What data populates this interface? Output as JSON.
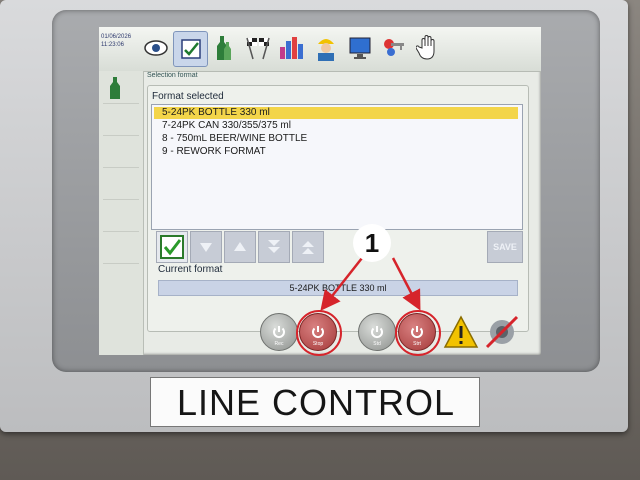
{
  "topbar": {
    "date": "01/06/2026",
    "time": "11:23:06",
    "tools": [
      "eye-icon",
      "format-selection-icon",
      "bottles-icon",
      "race-flags-icon",
      "bar-chart-icon",
      "operator-icon",
      "monitor-icon",
      "keys-icon",
      "hand-icon"
    ]
  },
  "header": {
    "subtitle": "Selection format"
  },
  "format_panel": {
    "title": "Format selected",
    "items": [
      "5-24PK BOTTLE 330 ml",
      "7-24PK CAN 330/355/375 ml",
      "8 - 750mL BEER/WINE BOTTLE",
      "9 - REWORK FORMAT"
    ],
    "selected_index": 0,
    "save_label": "SAVE",
    "current_label": "Current format",
    "current_value": "5-24PK BOTTLE 330 ml"
  },
  "bottom_buttons": [
    {
      "label": "Rec",
      "highlighted": false
    },
    {
      "label": "Stop",
      "highlighted": true
    },
    {
      "label": "Std",
      "highlighted": false
    },
    {
      "label": "Strt",
      "highlighted": true
    }
  ],
  "annotation": {
    "callout_number": "1",
    "color": "#d6242b"
  },
  "nameplate": {
    "text": "LINE CONTROL"
  }
}
